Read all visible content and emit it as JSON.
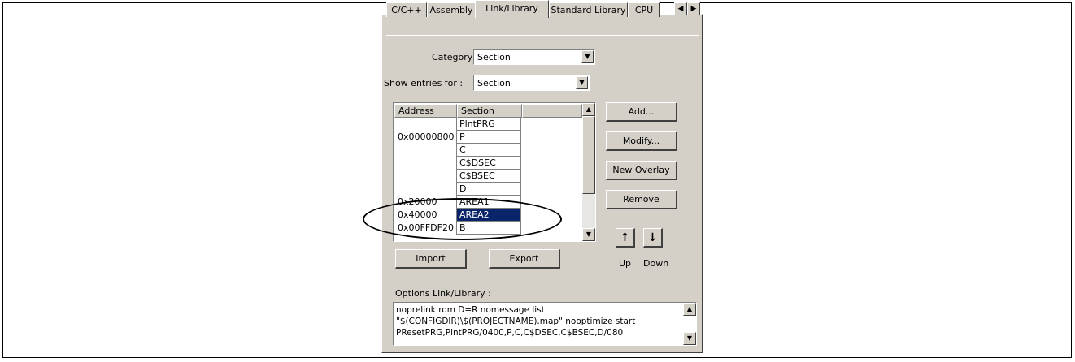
{
  "tabs": [
    "C/C++",
    "Assembly",
    "Link/Library",
    "Standard Library",
    "CPU"
  ],
  "active_tab": "Link/Library",
  "category": {
    "label": "Category :",
    "value": "Section"
  },
  "show_entries": {
    "label": "Show entries for :",
    "value": "Section"
  },
  "list": {
    "columns": [
      "Address",
      "Section"
    ],
    "rows": [
      {
        "address": "",
        "section": "PlntPRG"
      },
      {
        "address": "0x00000800",
        "section": "P"
      },
      {
        "address": "",
        "section": "C"
      },
      {
        "address": "",
        "section": "C$DSEC"
      },
      {
        "address": "",
        "section": "C$BSEC"
      },
      {
        "address": "",
        "section": "D"
      },
      {
        "address": "0x20000",
        "section": "AREA1"
      },
      {
        "address": "0x40000",
        "section": "AREA2"
      },
      {
        "address": "0x00FFDF20",
        "section": "B"
      }
    ],
    "selected": "AREA2"
  },
  "buttons": {
    "add": "Add...",
    "modify": "Modify...",
    "new_overlay": "New Overlay",
    "remove": "Remove",
    "import": "Import",
    "export": "Export",
    "up": "Up",
    "down": "Down"
  },
  "options": {
    "label": "Options Link/Library :",
    "lines": [
      "noprelink rom D=R nomessage  list",
      "\"$(CONFIGDIR)\\$(PROJECTNAME).map\" nooptimize start",
      "PResetPRG,PlntPRG/0400,P,C,C$DSEC,C$BSEC,D/080"
    ]
  },
  "colors": {
    "dialog_bg": "#d4d0c8",
    "selection": "#0a246a"
  }
}
